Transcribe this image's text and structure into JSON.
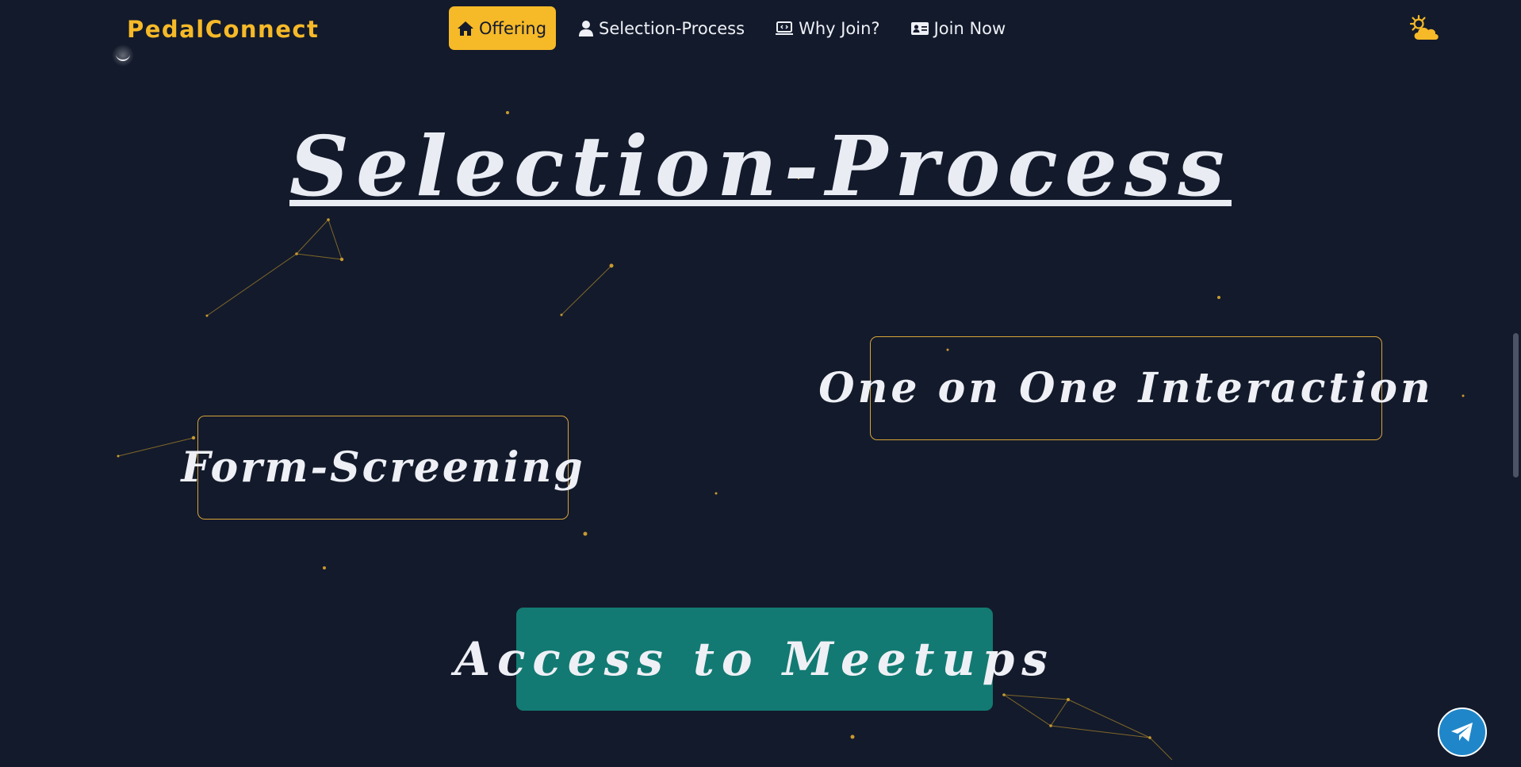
{
  "brand": {
    "name": "PedalConnect",
    "accent_color": "#f6b928",
    "background_color": "#131a2b"
  },
  "nav": {
    "items": [
      {
        "label": "Offering",
        "icon": "home-icon",
        "active": true
      },
      {
        "label": "Selection-Process",
        "icon": "user-icon",
        "active": false
      },
      {
        "label": "Why Join?",
        "icon": "laptop-code-icon",
        "active": false
      },
      {
        "label": "Join Now",
        "icon": "id-card-icon",
        "active": false
      }
    ],
    "theme_toggle_icon": "sun-behind-cloud-icon",
    "moon_icon": "crescent-moon-icon"
  },
  "main": {
    "title": "Selection-Process",
    "cards": [
      {
        "label": "Form-Screening",
        "style": "outlined"
      },
      {
        "label": "One on One Interaction",
        "style": "outlined"
      },
      {
        "label": "Access to Meetups",
        "style": "filled",
        "color": "#127a72"
      }
    ]
  },
  "fab": {
    "icon": "telegram-paper-plane-icon",
    "color": "#1f87c9"
  }
}
